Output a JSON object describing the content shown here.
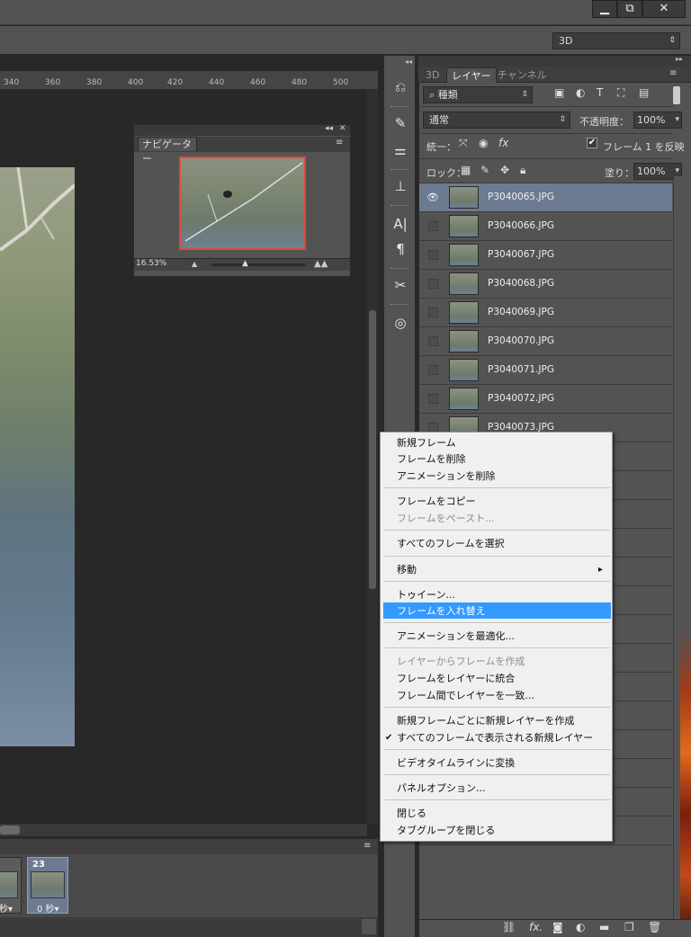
{
  "window": {
    "btn_minimize": "▁",
    "btn_restore": "⧉",
    "btn_close": "✕"
  },
  "options_bar": {
    "workspace": "3D",
    "workspace_arrow": "⇕"
  },
  "ruler": {
    "ticks": [
      "340",
      "360",
      "380",
      "400",
      "420",
      "440",
      "460",
      "480",
      "500"
    ]
  },
  "navigator": {
    "tab": "ナビゲーター",
    "zoom": "16.53%"
  },
  "animation": {
    "frames": [
      {
        "number": "",
        "delay": "秒▾"
      },
      {
        "number": "23",
        "delay": "0 秒▾"
      }
    ]
  },
  "layers_panel": {
    "tabs": [
      "3D",
      "レイヤー",
      "チャンネル"
    ],
    "filter_kind": "種類",
    "blend_mode": "通常",
    "opacity_label": "不透明度：",
    "opacity_value": "100%",
    "unify_label": "統一：",
    "propagate_label": "フレーム 1 を反映",
    "lock_label": "ロック：",
    "fill_label": "塗り：",
    "fill_value": "100%",
    "layers": [
      "P3040065.JPG",
      "P3040066.JPG",
      "P3040067.JPG",
      "P3040068.JPG",
      "P3040069.JPG",
      "P3040070.JPG",
      "P3040071.JPG",
      "P3040072.JPG",
      "P3040073.JPG"
    ]
  },
  "context_menu": {
    "items": [
      {
        "label": "新規フレーム"
      },
      {
        "label": "フレームを削除"
      },
      {
        "label": "アニメーションを削除"
      },
      {
        "label": "フレームをコピー"
      },
      {
        "label": "フレームをペースト..."
      },
      {
        "label": "すべてのフレームを選択"
      },
      {
        "label": "移動"
      },
      {
        "label": "トゥイーン..."
      },
      {
        "label": "フレームを入れ替え"
      },
      {
        "label": "アニメーションを最適化..."
      },
      {
        "label": "レイヤーからフレームを作成"
      },
      {
        "label": "フレームをレイヤーに統合"
      },
      {
        "label": "フレーム間でレイヤーを一致..."
      },
      {
        "label": "新規フレームごとに新規レイヤーを作成"
      },
      {
        "label": "すべてのフレームで表示される新規レイヤー"
      },
      {
        "label": "ビデオタイムラインに変換"
      },
      {
        "label": "パネルオプション..."
      },
      {
        "label": "閉じる"
      },
      {
        "label": "タブグループを閉じる"
      }
    ],
    "checkmark": "✔",
    "submenu_arrow": "▸"
  },
  "icons": {
    "tools": [
      "history-icon",
      "brush-presets-icon",
      "adjustments-icon",
      "clone-source-icon",
      "character-icon",
      "paragraph-icon",
      "tool-presets-icon",
      "creative-cloud-icon"
    ],
    "footer": [
      "link-icon",
      "fx-icon",
      "mask-icon",
      "adjustment-layer-icon",
      "folder-icon",
      "new-layer-icon",
      "trash-icon"
    ]
  },
  "colors": {
    "menu_highlight": "#3399ff",
    "selected_row": "#6c7b92",
    "nav_frame": "#e0473a"
  }
}
